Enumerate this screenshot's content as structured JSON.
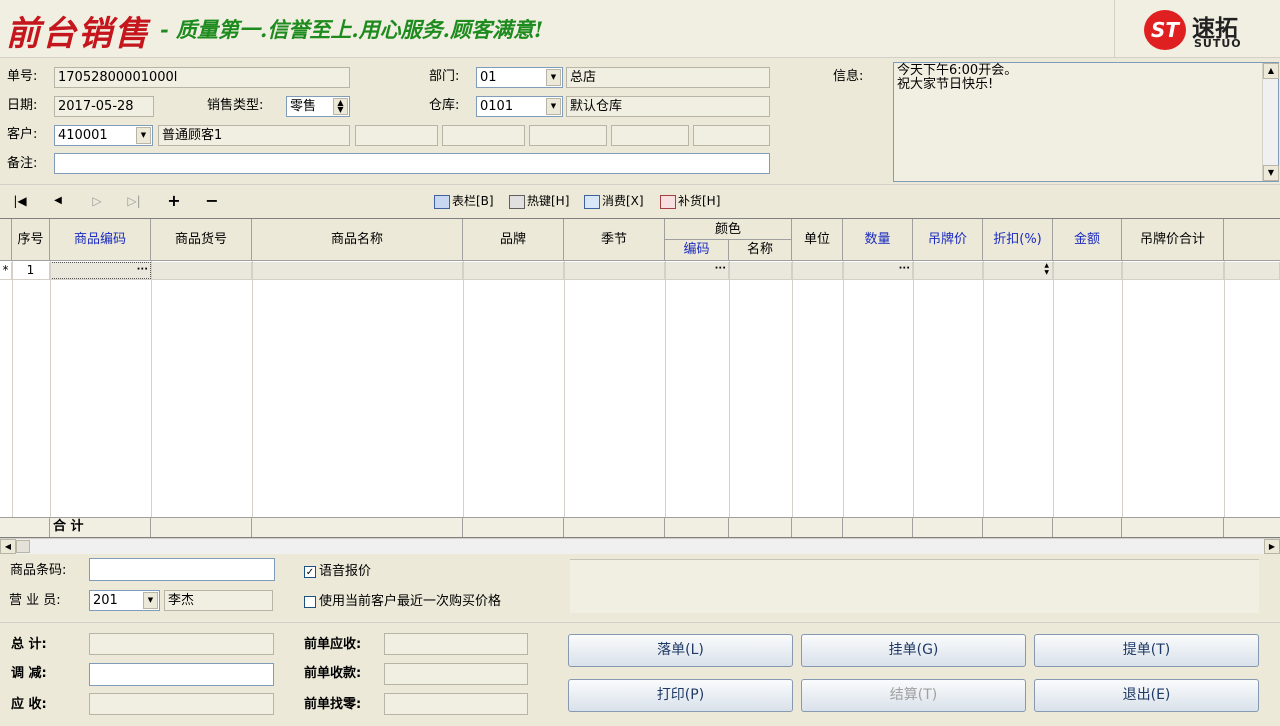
{
  "banner": {
    "title": "前台销售",
    "slogan": "- 质量第一.信誉至上.用心服务.顾客满意!",
    "logo_mark": "ST",
    "logo_cn": "速拓",
    "logo_en": "SUTUO"
  },
  "form": {
    "order_no_label": "单号:",
    "order_no": "17052800001000l",
    "date_label": "日期:",
    "date": "2017-05-28",
    "sale_type_label": "销售类型:",
    "sale_type": "零售",
    "customer_label": "客户:",
    "customer_code": "410001",
    "customer_name": "普通顾客1",
    "note_label": "备注:",
    "note": "",
    "dept_label": "部门:",
    "dept_code": "01",
    "dept_name": "总店",
    "warehouse_label": "仓库:",
    "warehouse_code": "0101",
    "warehouse_name": "默认仓库",
    "info_label": "信息:",
    "info_text": "今天下午6:00开会。\n祝大家节日快乐!"
  },
  "toolbar": {
    "columns": "表栏[B]",
    "hotkey": "热键[H]",
    "consume": "消费[X]",
    "restock": "补货[H]"
  },
  "grid": {
    "headers": {
      "seq": "序号",
      "code": "商品编码",
      "sku": "商品货号",
      "name": "商品名称",
      "brand": "品牌",
      "season": "季节",
      "color": "颜色",
      "color_code": "编码",
      "color_name": "名称",
      "unit": "单位",
      "qty": "数量",
      "tag_price": "吊牌价",
      "discount": "折扣(%)",
      "amount": "金额",
      "tag_total": "吊牌价合计"
    },
    "rows": [
      {
        "marker": "*",
        "seq": "1"
      }
    ],
    "total_label": "合  计"
  },
  "bottom": {
    "barcode_label": "商品条码:",
    "barcode": "",
    "voice_label": "语音报价",
    "voice_checked": "✓",
    "last_price_label": "使用当前客户最近一次购买价格",
    "sales_label": "营 业 员:",
    "sales_code": "201",
    "sales_name": "李杰",
    "total_label": "总    计:",
    "adjust_label": "调    减:",
    "receivable_label": "应    收:",
    "prev_receivable_label": "前单应收:",
    "prev_paid_label": "前单收款:",
    "prev_change_label": "前单找零:"
  },
  "buttons": {
    "drop": "落单(L)",
    "hold": "挂单(G)",
    "retrieve": "提单(T)",
    "print": "打印(P)",
    "settle": "结算(T)",
    "exit": "退出(E)"
  },
  "colors": {
    "title_red": "#C4161C",
    "slogan_green": "#1E8B1E",
    "header_blue": "#1A2BC0"
  }
}
